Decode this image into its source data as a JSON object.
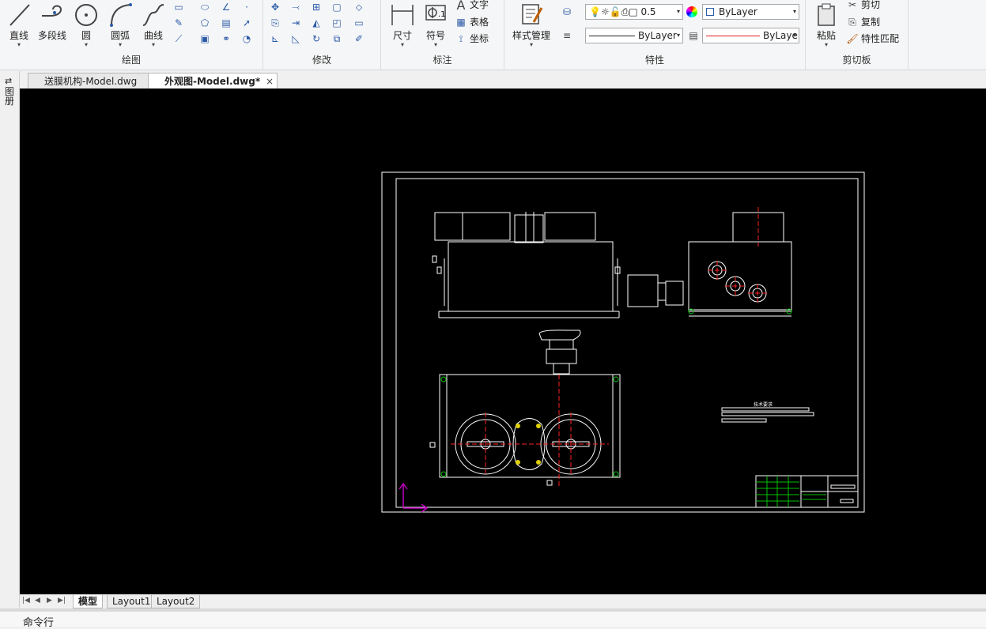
{
  "ribbon": {
    "draw": {
      "label": "绘图",
      "buttons": [
        {
          "label": "直线",
          "icon": "line-icon"
        },
        {
          "label": "多段线",
          "icon": "polyline-icon"
        },
        {
          "label": "圆",
          "icon": "circle-icon"
        },
        {
          "label": "圆弧",
          "icon": "arc-icon"
        },
        {
          "label": "曲线",
          "icon": "spline-icon"
        }
      ]
    },
    "modify": {
      "label": "修改"
    },
    "annotate": {
      "label": "标注",
      "dimension": "尺寸",
      "symbol": "符号",
      "text": "文字",
      "table": "表格",
      "coordinate": "坐标"
    },
    "properties": {
      "label": "特性",
      "style_manager": "样式管理",
      "lineweight": "0.5",
      "color": "ByLayer",
      "linetype": "ByLayer",
      "linecolor": "ByLayer"
    },
    "clipboard": {
      "label": "剪切板",
      "paste": "粘贴",
      "cut": "剪切",
      "copy": "复制",
      "match": "特性匹配"
    }
  },
  "tabs": [
    {
      "label": "送膜机构-Model.dwg",
      "active": false
    },
    {
      "label": "外观图-Model.dwg*",
      "active": true
    }
  ],
  "left_panel_label": "图册",
  "layout_tabs": [
    {
      "label": "模型",
      "active": true
    },
    {
      "label": "Layout1",
      "active": false
    },
    {
      "label": "Layout2",
      "active": false
    }
  ],
  "command_line": "命令行",
  "drawing": {
    "tech_requirements_title": "技术要求"
  },
  "colors": {
    "viewport_bg": "#000000",
    "line_white": "#ffffff",
    "center_red": "#ff2020",
    "hatch_green": "#00c000",
    "ucs_magenta": "#c000c0",
    "accent_blue": "#2b5aa8"
  }
}
